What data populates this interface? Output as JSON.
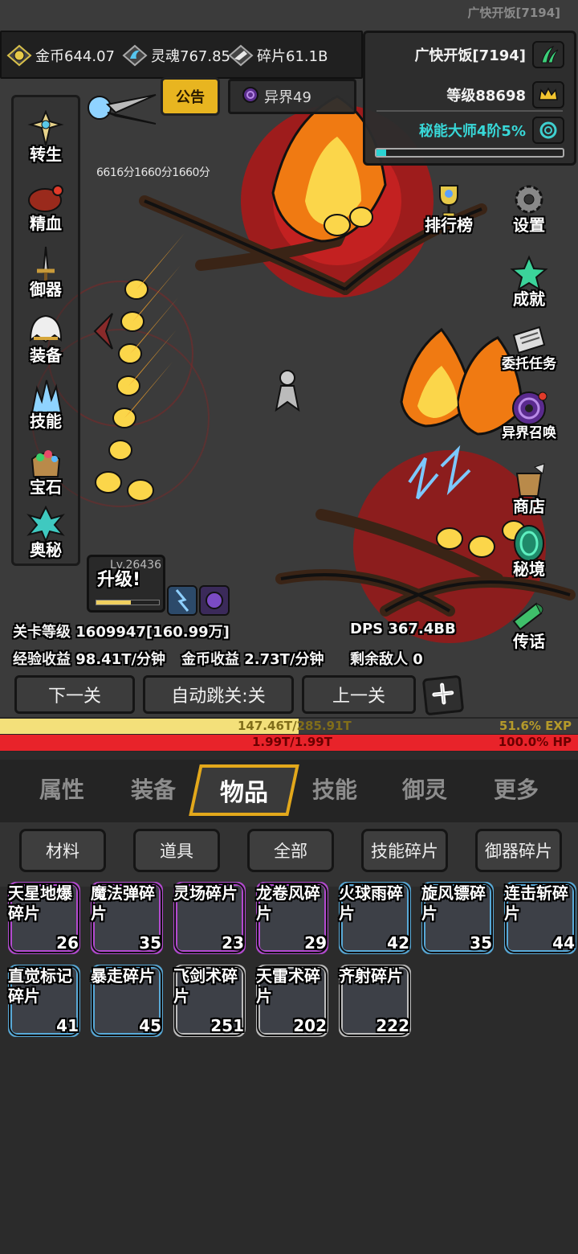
{
  "top": {
    "player_id": "广快开饭[7194]"
  },
  "resources": [
    {
      "name": "gold",
      "icon": "gold-coin-icon",
      "text": "金币644.07"
    },
    {
      "name": "soul",
      "icon": "soul-icon",
      "text": "灵魂767.85"
    },
    {
      "name": "shard",
      "icon": "shard-icon",
      "text": "碎片61.1B"
    }
  ],
  "player_panel": {
    "name": "广快开饭[7194]",
    "level": "等级88698",
    "title": "秘能大师4阶5%",
    "title_progress": 0.05
  },
  "notice": {
    "label": "公告"
  },
  "other_realm": {
    "label": "异界49"
  },
  "scores": [
    "6616分",
    "1660分",
    "1660分"
  ],
  "left_menu": [
    {
      "id": "rebirth",
      "label": "转生",
      "icon": "cross-icon"
    },
    {
      "id": "essence",
      "label": "精血",
      "icon": "meat-icon"
    },
    {
      "id": "weapon",
      "label": "御器",
      "icon": "sword-icon"
    },
    {
      "id": "equipment",
      "label": "装备",
      "icon": "helmet-icon"
    },
    {
      "id": "skills",
      "label": "技能",
      "icon": "crystal-icon"
    },
    {
      "id": "gems",
      "label": "宝石",
      "icon": "gem-bag-icon"
    },
    {
      "id": "arcana",
      "label": "奥秘",
      "icon": "arcane-icon"
    }
  ],
  "right_menu": [
    {
      "id": "ranking",
      "label": "排行榜",
      "icon": "trophy-icon"
    },
    {
      "id": "settings",
      "label": "设置",
      "icon": "gear-icon"
    },
    {
      "id": "achievements",
      "label": "成就",
      "icon": "star-icon"
    },
    {
      "id": "quests",
      "label": "委托任务",
      "icon": "scroll-icon"
    },
    {
      "id": "summon",
      "label": "异界召唤",
      "icon": "vortex-icon"
    },
    {
      "id": "shop",
      "label": "商店",
      "icon": "pot-icon"
    },
    {
      "id": "secret",
      "label": "秘境",
      "icon": "portal-icon"
    },
    {
      "id": "teleport",
      "label": "传话",
      "icon": "horn-icon"
    }
  ],
  "level_box": {
    "lv": "Lv.26436",
    "upgrade": "升级!",
    "progress": 0.55
  },
  "stats": {
    "stage": "关卡等级 1609947[160.99万]",
    "dps": "DPS 367.4BB",
    "exp_income": "经验收益 98.41T/分钟",
    "gold_income": "金币收益 2.73T/分钟",
    "enemies_left": "剩余敌人 0"
  },
  "nav": {
    "next": "下一关",
    "auto": "自动跳关:关",
    "prev": "上一关"
  },
  "exp": {
    "text": "147.46T/285.91T",
    "percent": "51.6% EXP",
    "fill": 0.516
  },
  "hp": {
    "text": "1.99T/1.99T",
    "percent": "100.0%  HP",
    "fill": 1.0
  },
  "tabs": [
    "属性",
    "装备",
    "物品",
    "技能",
    "御灵",
    "更多"
  ],
  "filters": [
    "材料",
    "道具",
    "全部",
    "技能碎片",
    "御器碎片"
  ],
  "items": [
    {
      "name": "天星地爆碎片",
      "count": "26",
      "rarity": "purple"
    },
    {
      "name": "魔法弹碎片",
      "count": "35",
      "rarity": "purple"
    },
    {
      "name": "灵场碎片",
      "count": "23",
      "rarity": "purple"
    },
    {
      "name": "龙卷风碎片",
      "count": "29",
      "rarity": "purple"
    },
    {
      "name": "火球雨碎片",
      "count": "42",
      "rarity": "blue"
    },
    {
      "name": "旋风镖碎片",
      "count": "35",
      "rarity": "blue"
    },
    {
      "name": "连击斩碎片",
      "count": "44",
      "rarity": "blue"
    },
    {
      "name": "直觉标记碎片",
      "count": "41",
      "rarity": "blue"
    },
    {
      "name": "暴走碎片",
      "count": "45",
      "rarity": "blue"
    },
    {
      "name": "飞剑术碎片",
      "count": "251",
      "rarity": "gray"
    },
    {
      "name": "天雷术碎片",
      "count": "202",
      "rarity": "gray"
    },
    {
      "name": "齐射碎片",
      "count": "222",
      "rarity": "gray"
    }
  ]
}
